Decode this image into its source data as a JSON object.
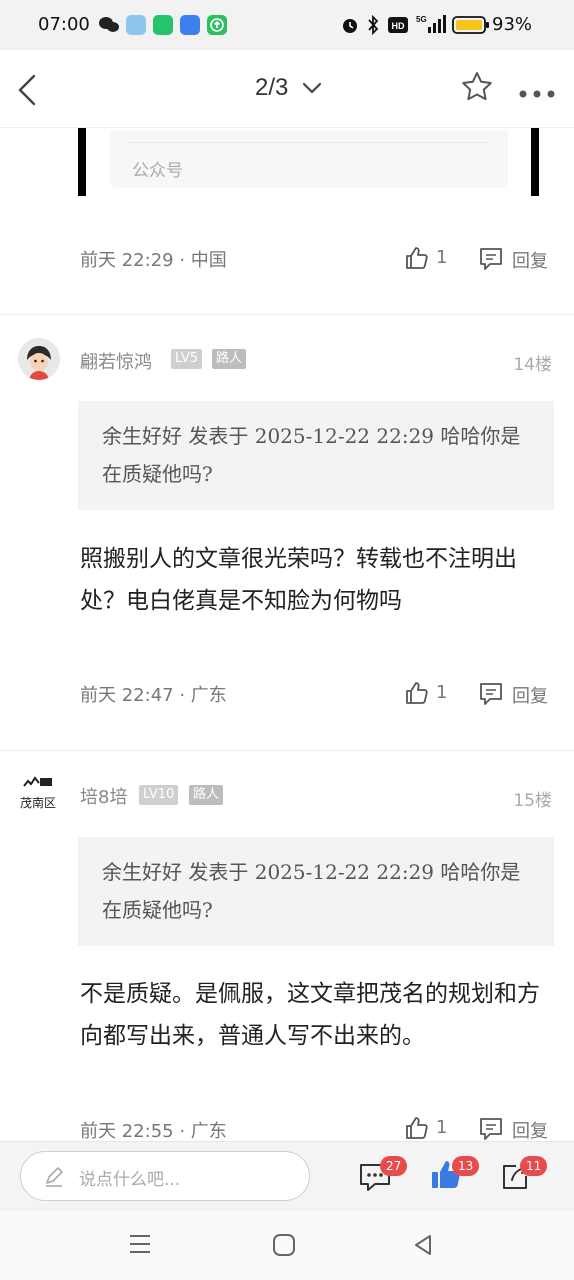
{
  "status": {
    "time": "07:00",
    "battery": "93%"
  },
  "nav": {
    "page_indicator": "2/3"
  },
  "top_card": {
    "label": "公众号"
  },
  "post13": {
    "meta": "前天 22:29 · 中国",
    "likes": "1",
    "reply": "回复"
  },
  "post14": {
    "username": "翩若惊鸿",
    "level": "LV5",
    "role": "路人",
    "floor": "14楼",
    "quote": "余生好好 发表于 2025-12-22 22:29 哈哈你是在质疑他吗?",
    "content": "照搬别人的文章很光荣吗？转载也不注明出处？电白佬真是不知脸为何物吗",
    "meta": "前天 22:47 · 广东",
    "likes": "1",
    "reply": "回复"
  },
  "post15": {
    "username": "培8培",
    "level": "LV10",
    "role": "路人",
    "floor": "15楼",
    "avatar_text": "茂南区",
    "quote": "余生好好 发表于 2025-12-22 22:29 哈哈你是在质疑他吗?",
    "content": "不是质疑。是佩服，这文章把茂名的规划和方向都写出来，普通人写不出来的。",
    "meta": "前天 22:55 · 广东",
    "likes": "1",
    "reply": "回复"
  },
  "bottom": {
    "input_placeholder": "说点什么吧...",
    "comments_count": "27",
    "likes_count": "13",
    "shares_count": "11"
  },
  "colors": {
    "badge_red": "#e84b4b",
    "like_blue": "#3b7be0"
  }
}
